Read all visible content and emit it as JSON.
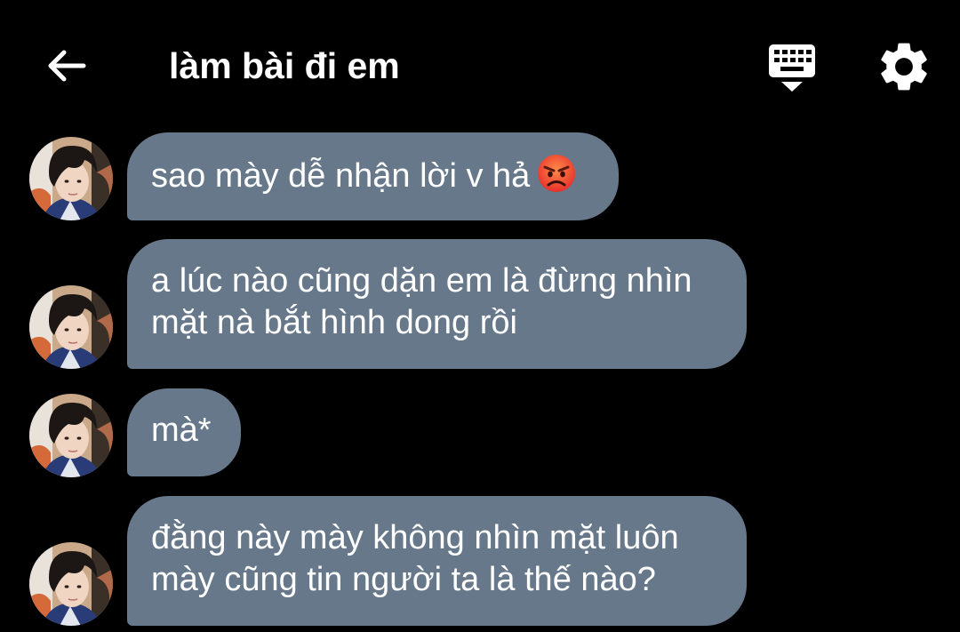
{
  "header": {
    "title": "làm bài đi em",
    "back_icon": "arrow-left-icon",
    "keyboard_icon": "keyboard-hide-icon",
    "settings_icon": "gear-icon"
  },
  "messages": [
    {
      "lines": [
        "sao mày dễ nhận lời v hả"
      ],
      "emoji": "angry-face-emoji"
    },
    {
      "lines": [
        "a lúc nào cũng dặn em là đừng nhìn",
        "mặt nà bắt hình dong rồi"
      ]
    },
    {
      "lines": [
        "mà*"
      ]
    },
    {
      "lines": [
        "đằng này mày không nhìn mặt luôn",
        "mày cũng tin người ta là thế nào?"
      ]
    }
  ],
  "colors": {
    "background": "#000000",
    "bubble": "#66788a",
    "text": "#ffffff"
  }
}
